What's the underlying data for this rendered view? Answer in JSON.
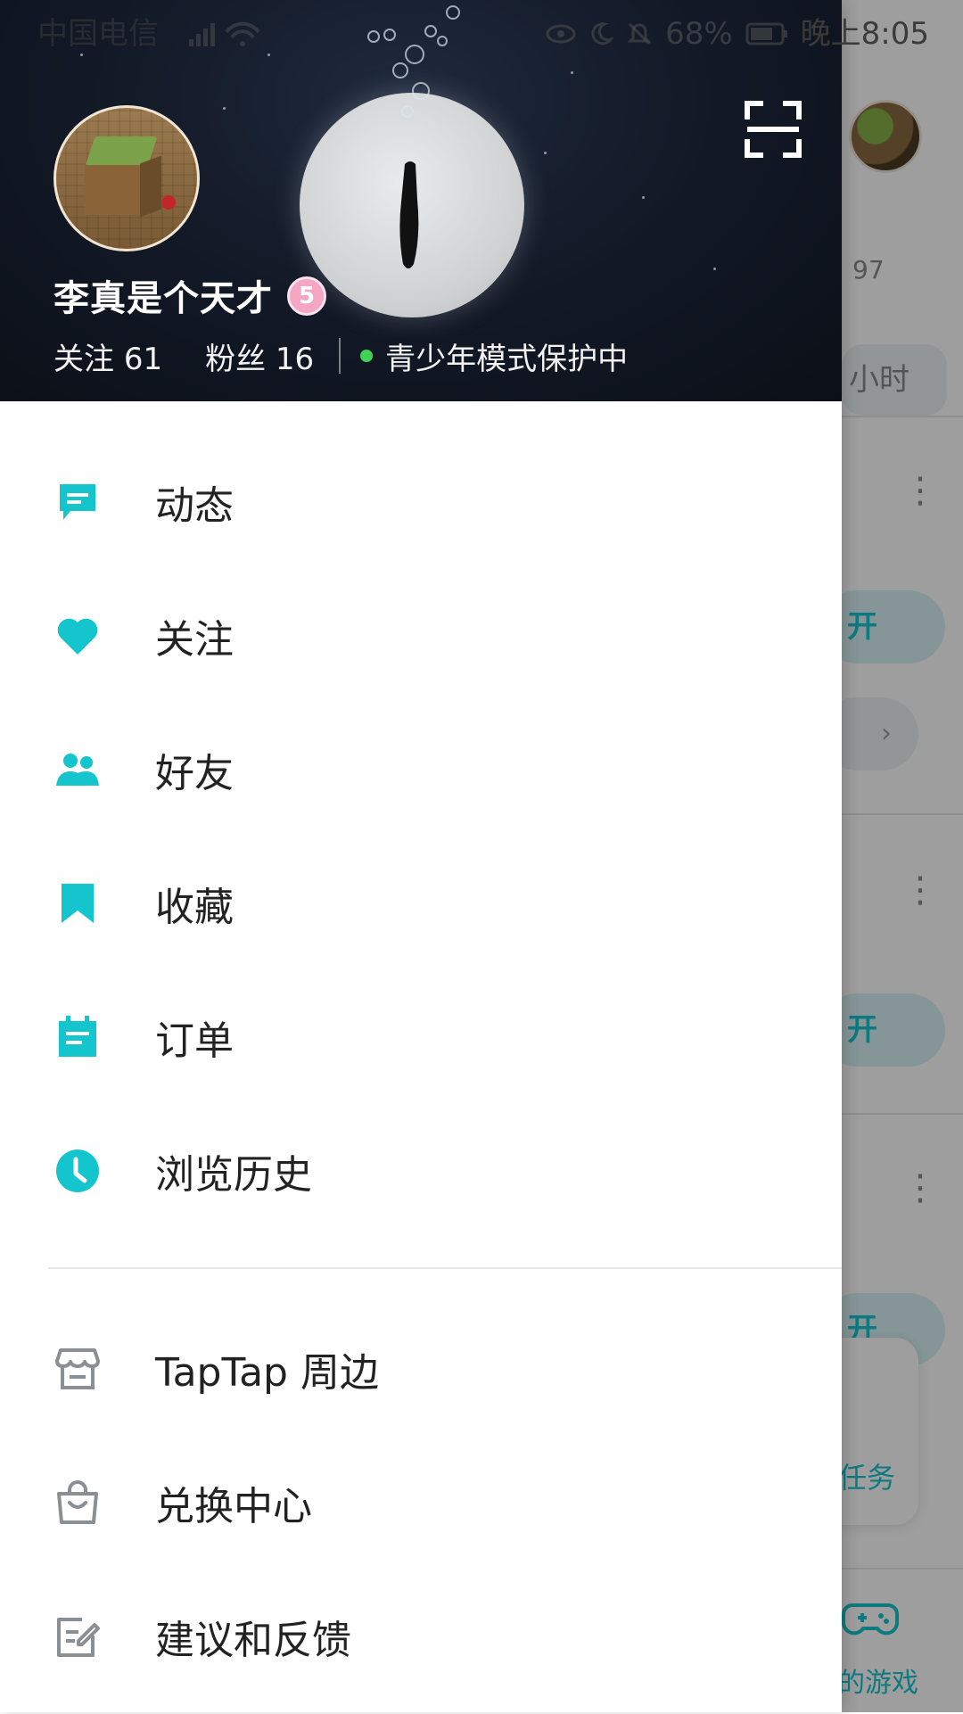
{
  "status_bar": {
    "carrier": "中国电信",
    "battery": "68%",
    "time": "晚上8:05"
  },
  "profile": {
    "username": "李真是个天才",
    "level": "5",
    "following_label": "关注",
    "following_count": "61",
    "followers_label": "粉丝",
    "followers_count": "16",
    "teen_mode_text": "青少年模式保护中"
  },
  "menu": {
    "primary": [
      {
        "label": "动态",
        "icon": "message-icon"
      },
      {
        "label": "关注",
        "icon": "heart-icon"
      },
      {
        "label": "好友",
        "icon": "friends-icon"
      },
      {
        "label": "收藏",
        "icon": "bookmark-icon"
      },
      {
        "label": "订单",
        "icon": "order-icon"
      },
      {
        "label": "浏览历史",
        "icon": "clock-icon"
      }
    ],
    "secondary": [
      {
        "label": "TapTap 周边",
        "icon": "store-icon"
      },
      {
        "label": "兑换中心",
        "icon": "shopping-bag-icon"
      },
      {
        "label": "建议和反馈",
        "icon": "feedback-icon"
      }
    ]
  },
  "background_app": {
    "count_text": "97",
    "time_pill": "小时",
    "button_text": "开",
    "task_label": "任务",
    "tab_label": "的游戏"
  },
  "colors": {
    "accent": "#15c5ce",
    "secondary_icon": "#8a8f94",
    "teen_mode_dot": "#3fd255",
    "level_badge": "#f4a6c3"
  }
}
